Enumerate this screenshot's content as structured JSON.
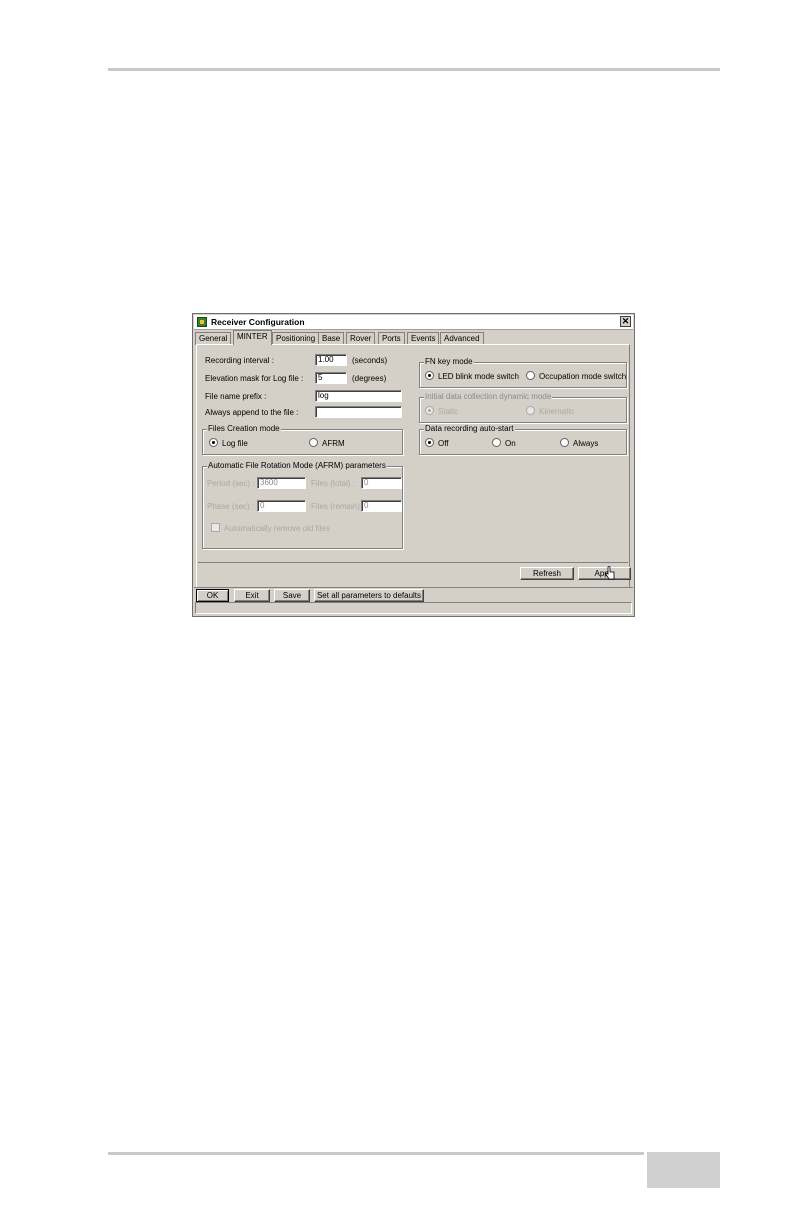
{
  "window": {
    "title": "Receiver Configuration",
    "close_glyph": "✕",
    "icon": "app-icon"
  },
  "tabs": [
    {
      "label": "General",
      "active": false
    },
    {
      "label": "MINTER",
      "active": true
    },
    {
      "label": "Positioning",
      "active": false
    },
    {
      "label": "Base",
      "active": false
    },
    {
      "label": "Rover",
      "active": false
    },
    {
      "label": "Ports",
      "active": false
    },
    {
      "label": "Events",
      "active": false
    },
    {
      "label": "Advanced",
      "active": false
    }
  ],
  "minter": {
    "recording_interval": {
      "label": "Recording interval :",
      "value": "1.00",
      "unit": "(seconds)"
    },
    "elevation_mask": {
      "label": "Elevation mask for Log file :",
      "value": "5",
      "unit": "(degrees)"
    },
    "file_prefix": {
      "label": "File name prefix :",
      "value": "log"
    },
    "append": {
      "label": "Always append to the file :",
      "value": ""
    },
    "files_creation": {
      "title": "Files Creation mode",
      "options": [
        {
          "label": "Log file",
          "selected": true
        },
        {
          "label": "AFRM",
          "selected": false
        }
      ]
    },
    "afrm": {
      "title": "Automatic File Rotation Mode (AFRM) parameters",
      "period": {
        "label": "Period (sec) :",
        "value": "3600"
      },
      "files_total": {
        "label": "Files (total) :",
        "value": "0"
      },
      "phase": {
        "label": "Phase (sec) :",
        "value": "0"
      },
      "files_remain": {
        "label": "Files (remain) :",
        "value": "0"
      },
      "auto_remove": {
        "label": "Automatically remove old files",
        "checked": false
      }
    },
    "fn_key": {
      "title": "FN key mode",
      "options": [
        {
          "label": "LED blink mode switch",
          "selected": true
        },
        {
          "label": "Occupation mode switch",
          "selected": false
        }
      ]
    },
    "initial_dynamic": {
      "title": "Initial data collection dynamic mode",
      "options": [
        {
          "label": "Static",
          "selected": true
        },
        {
          "label": "Kinematic",
          "selected": false
        }
      ]
    },
    "auto_start": {
      "title": "Data recording auto-start",
      "options": [
        {
          "label": "Off",
          "selected": true
        },
        {
          "label": "On",
          "selected": false
        },
        {
          "label": "Always",
          "selected": false
        }
      ]
    }
  },
  "panel_buttons": {
    "refresh": "Refresh",
    "apply": "Apply"
  },
  "bottom_buttons": {
    "ok": "OK",
    "exit": "Exit",
    "save": "Save",
    "defaults": "Set all parameters to defaults"
  }
}
